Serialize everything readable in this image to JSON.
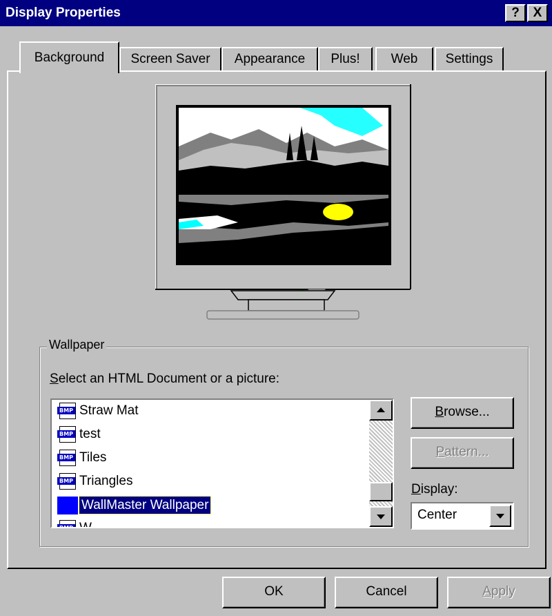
{
  "window": {
    "title": "Display Properties",
    "help_btn": "?",
    "close_btn": "X"
  },
  "tabs": [
    {
      "label": "Background",
      "active": true
    },
    {
      "label": "Screen Saver"
    },
    {
      "label": "Appearance"
    },
    {
      "label": "Plus!"
    },
    {
      "label": "Web"
    },
    {
      "label": "Settings"
    }
  ],
  "wallpaper": {
    "group_label": "Wallpaper",
    "select_label_accel": "S",
    "select_label_rest": "elect an HTML Document or a picture:",
    "items": [
      {
        "icon": "BMP",
        "label": "Straw Mat"
      },
      {
        "icon": "BMP",
        "label": "test"
      },
      {
        "icon": "BMP",
        "label": "Tiles"
      },
      {
        "icon": "BMP",
        "label": "Triangles"
      },
      {
        "icon": "html",
        "label": "WallMaster Wallpaper",
        "selected": true
      },
      {
        "icon": "BMP",
        "label": "W..."
      }
    ],
    "browse_accel": "B",
    "browse_rest": "rowse...",
    "pattern_accel": "P",
    "pattern_rest": "attern...",
    "display_label_accel": "D",
    "display_label_rest": "isplay:",
    "display_value": "Center"
  },
  "footer": {
    "ok": "OK",
    "cancel": "Cancel",
    "apply_accel": "A",
    "apply_rest": "pply"
  },
  "colors": {
    "title_bar": "#000080",
    "face": "#c0c0c0",
    "selection": "#000080"
  }
}
